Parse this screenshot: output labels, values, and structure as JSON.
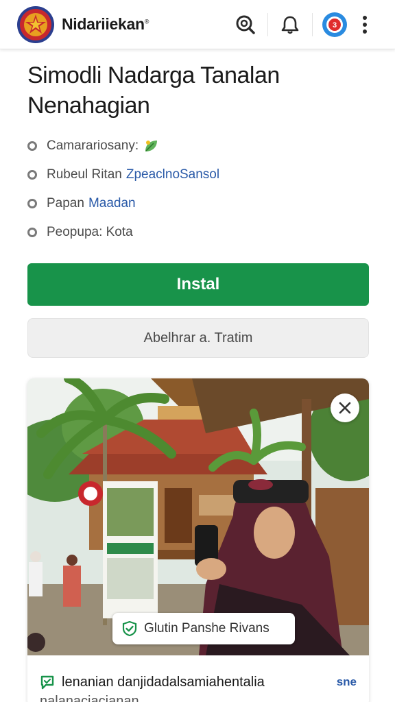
{
  "appbar": {
    "brand": "Nidariiekan",
    "brand_mark": "®",
    "icons": [
      "search-icon",
      "bell-icon",
      "app-badge-icon",
      "more-vert-icon"
    ],
    "badge_text": "3"
  },
  "title": "Simodli Nadarga Tanalan Nenahagian",
  "meta": [
    {
      "label": "Camarariosany:",
      "link": ""
    },
    {
      "label": "Rubeul Ritan",
      "link": "ZpeaclnoSansol"
    },
    {
      "label": "Papan",
      "link": "Maadan"
    },
    {
      "label": "Peopupa: Kota",
      "link": ""
    }
  ],
  "buttons": {
    "install": "Instal",
    "secondary": "Abelhrar a. Tratim"
  },
  "card": {
    "chip_label": "Glutin Panshe Rivans",
    "footer_text": "lenanian danjidadalsamiahentalia",
    "footer_badge": "sne",
    "footer_sub": "nalanaciacianan"
  },
  "colors": {
    "accent_green": "#18934a",
    "link_blue": "#2a5aa8",
    "logo_red": "#c8282d",
    "logo_gold": "#f2c230",
    "badge_blue": "#2a8be0"
  }
}
